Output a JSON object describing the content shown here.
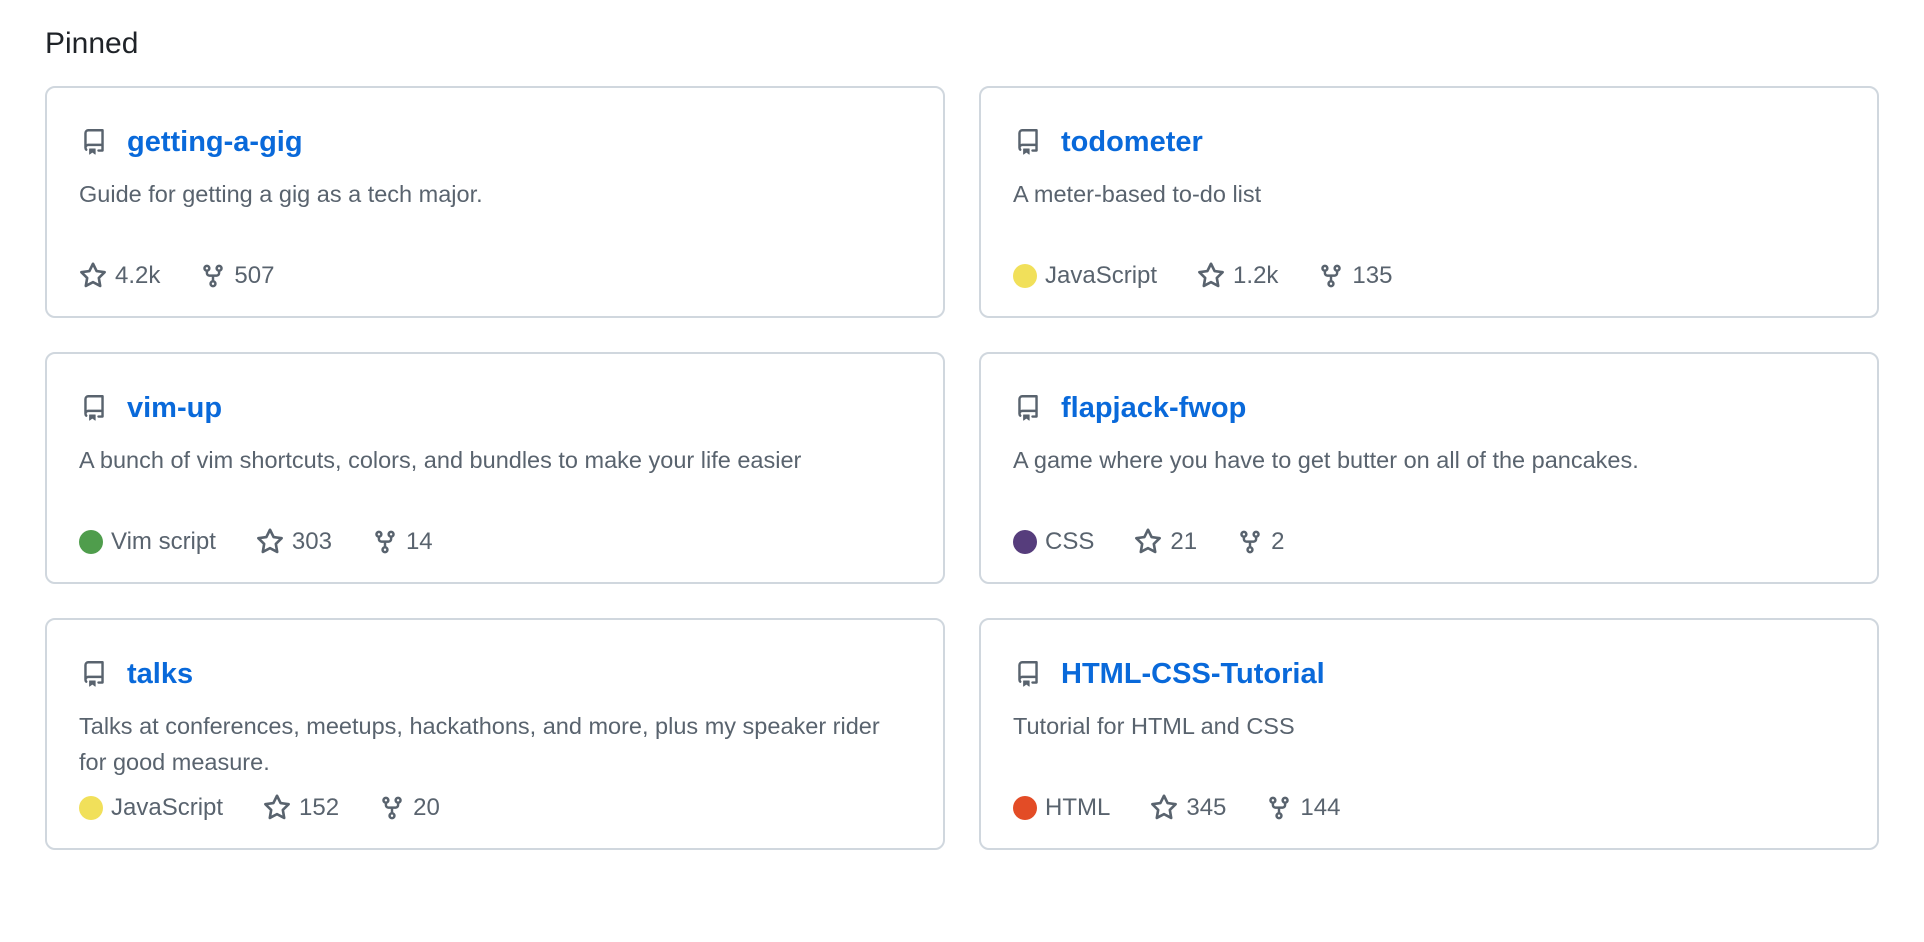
{
  "section": {
    "title": "Pinned"
  },
  "repos": [
    {
      "name": "getting-a-gig",
      "description": "Guide for getting a gig as a tech major.",
      "language": "",
      "language_color": "",
      "stars": "4.2k",
      "forks": "507"
    },
    {
      "name": "todometer",
      "description": "A meter-based to-do list",
      "language": "JavaScript",
      "language_color": "#f1e05a",
      "stars": "1.2k",
      "forks": "135"
    },
    {
      "name": "vim-up",
      "description": "A bunch of vim shortcuts, colors, and bundles to make your life easier",
      "language": "Vim script",
      "language_color": "#4f9d4c",
      "stars": "303",
      "forks": "14"
    },
    {
      "name": "flapjack-fwop",
      "description": "A game where you have to get butter on all of the pancakes.",
      "language": "CSS",
      "language_color": "#563d7c",
      "stars": "21",
      "forks": "2"
    },
    {
      "name": "talks",
      "description": "Talks at conferences, meetups, hackathons, and more, plus my speaker rider for good measure.",
      "language": "JavaScript",
      "language_color": "#f1e05a",
      "stars": "152",
      "forks": "20"
    },
    {
      "name": "HTML-CSS-Tutorial",
      "description": "Tutorial for HTML and CSS",
      "language": "HTML",
      "language_color": "#e34c26",
      "stars": "345",
      "forks": "144"
    }
  ],
  "icons": {
    "repo": "repo-icon",
    "star": "star-icon",
    "fork": "fork-icon"
  },
  "colors": {
    "link": "#0969da",
    "muted_text": "#59636e",
    "border": "#d0d7de"
  }
}
